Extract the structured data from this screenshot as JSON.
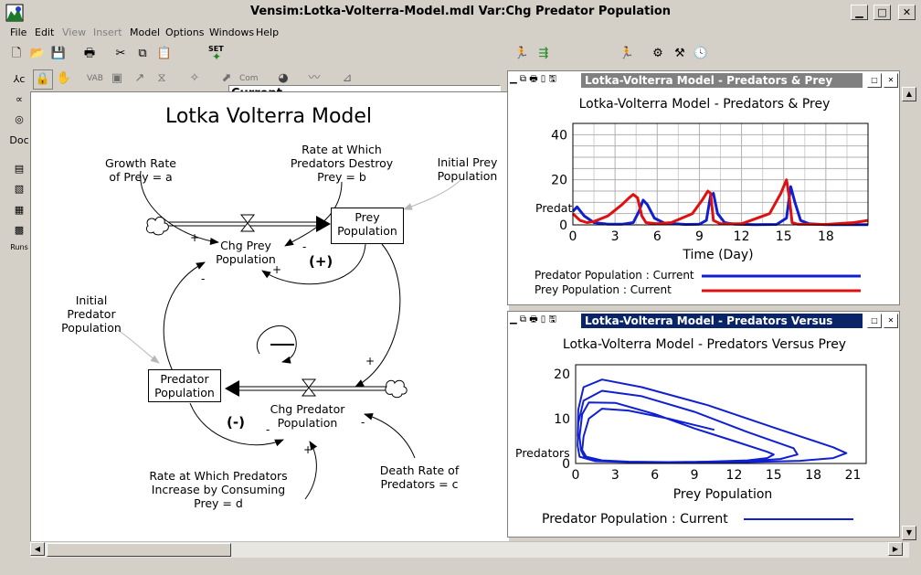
{
  "window": {
    "title": "Vensim:Lotka-Volterra-Model.mdl Var:Chg Predator Population",
    "min_glyph": "▁",
    "max_glyph": "□",
    "close_glyph": "✕"
  },
  "menu": [
    "File",
    "Edit",
    "View",
    "Insert",
    "Model",
    "Options",
    "Windows",
    "Help"
  ],
  "toolbar": {
    "set_label": "SET",
    "run_name": "Current"
  },
  "left_tools": {
    "doc_label": "Doc",
    "runs_label": "Runs"
  },
  "diagram": {
    "title": "Lotka Volterra Model",
    "prey_population": "Prey\nPopulation",
    "predator_population": "Predator\nPopulation",
    "chg_prey": "Chg Prey\nPopulation",
    "chg_predator": "Chg Predator\nPopulation",
    "growth_rate": "Growth Rate\nof Prey = a",
    "rate_destroy": "Rate at Which\nPredators Destroy\nPrey = b",
    "initial_prey": "Initial Prey\nPopulation",
    "initial_predator": "Initial\nPredator\nPopulation",
    "rate_increase": "Rate at Which Predators\nIncrease by Consuming\nPrey = d",
    "death_rate": "Death Rate of\nPredators = c",
    "loop_positive": "(+)",
    "loop_negative": "(-)",
    "plus": "+",
    "minus": "-"
  },
  "graph1": {
    "window_title": "Lotka-Volterra Model - Predators & Prey",
    "title": "Lotka-Volterra Model - Predators & Prey",
    "ylabel": "Predators",
    "xlabel": "Time (Day)",
    "legend": [
      {
        "label": "Predator Population : Current",
        "color": "#1020d0"
      },
      {
        "label": "Prey Population : Current",
        "color": "#e01010"
      }
    ]
  },
  "graph2": {
    "window_title": "Lotka-Volterra Model - Predators Versus Prey",
    "title": "Lotka-Volterra Model - Predators Versus Prey",
    "ylabel": "Predators",
    "xlabel": "Prey Population",
    "legend": [
      {
        "label": "Predator Population : Current",
        "color": "#1020d0"
      }
    ]
  },
  "chart_data": [
    {
      "type": "line",
      "title": "Lotka-Volterra Model - Predators & Prey",
      "xlabel": "Time (Day)",
      "ylabel": "Predators",
      "xlim": [
        0,
        21
      ],
      "ylim": [
        0,
        45
      ],
      "xticks": [
        "0",
        "3",
        "6",
        "9",
        "12",
        "15",
        "18"
      ],
      "yticks": [
        "0",
        "20",
        "40"
      ],
      "grid": true,
      "series": [
        {
          "name": "Predator Population : Current",
          "color": "#1020d0",
          "x": [
            0,
            0.3,
            0.8,
            1.5,
            2.5,
            3.5,
            4.3,
            4.7,
            5.0,
            5.3,
            5.8,
            6.5,
            8,
            9,
            9.5,
            9.8,
            10.0,
            10.3,
            10.8,
            11.5,
            13,
            14.5,
            15.2,
            15.5,
            15.8,
            16.2,
            16.8,
            18,
            21
          ],
          "y": [
            6,
            8,
            4,
            1,
            0.3,
            0.3,
            1,
            6,
            11,
            9,
            3,
            0.8,
            0.2,
            0.3,
            2,
            13,
            14,
            5,
            1,
            0.3,
            0.1,
            0.2,
            3,
            17,
            10,
            2,
            0.5,
            0.1,
            0.1
          ]
        },
        {
          "name": "Prey Population : Current",
          "color": "#e01010",
          "x": [
            0,
            0.5,
            1.0,
            1.5,
            2.5,
            3.5,
            4.0,
            4.3,
            4.6,
            4.9,
            5.2,
            6,
            7,
            8.5,
            9.2,
            9.6,
            9.8,
            10.0,
            10.5,
            12,
            14,
            14.8,
            15.2,
            15.4,
            15.6,
            16,
            18,
            20,
            21
          ],
          "y": [
            5,
            2,
            1,
            1.5,
            4,
            9,
            12,
            13.5,
            12,
            4,
            1,
            0.5,
            1,
            5,
            11,
            15,
            14,
            2,
            0.5,
            0.5,
            5,
            14,
            20,
            12,
            1,
            0.3,
            0.2,
            1,
            2
          ]
        }
      ]
    },
    {
      "type": "line",
      "title": "Lotka-Volterra Model - Predators Versus Prey",
      "xlabel": "Prey Population",
      "ylabel": "Predators",
      "xlim": [
        0,
        22
      ],
      "ylim": [
        0,
        22
      ],
      "xticks": [
        "0",
        "3",
        "6",
        "9",
        "12",
        "15",
        "18",
        "21"
      ],
      "yticks": [
        "0",
        "10",
        "20"
      ],
      "grid": false,
      "series": [
        {
          "name": "Predator Population : Current",
          "color": "#1020d0",
          "x": [
            10.5,
            7,
            4,
            2,
            1,
            0.6,
            0.5,
            0.8,
            2,
            4,
            7,
            10,
            13,
            14.5,
            15,
            14.5,
            12,
            9,
            6,
            3,
            1,
            0.5,
            0.3,
            0.4,
            0.7,
            2,
            5,
            9,
            13,
            15.5,
            16.8,
            16.5,
            13,
            9,
            5,
            2,
            0.6,
            0.2,
            0.15,
            0.3,
            1.5,
            4,
            8,
            13,
            17,
            19.5,
            20.5,
            19.5,
            15,
            10,
            5,
            2,
            0.6,
            0.2,
            0.15
          ],
          "y": [
            7.5,
            10,
            11.8,
            12.2,
            10,
            6,
            3,
            1.5,
            0.7,
            0.4,
            0.3,
            0.4,
            0.7,
            1.2,
            2,
            2.6,
            5,
            7.8,
            11,
            13.5,
            13.6,
            11,
            6,
            3,
            1.2,
            0.5,
            0.3,
            0.3,
            0.5,
            1,
            2,
            3.4,
            7,
            11.5,
            15,
            16.2,
            14,
            9,
            4,
            1.5,
            0.5,
            0.3,
            0.2,
            0.3,
            0.6,
            1.2,
            2.3,
            3.6,
            8,
            13,
            17,
            18.7,
            17,
            12,
            6
          ]
        }
      ]
    }
  ]
}
